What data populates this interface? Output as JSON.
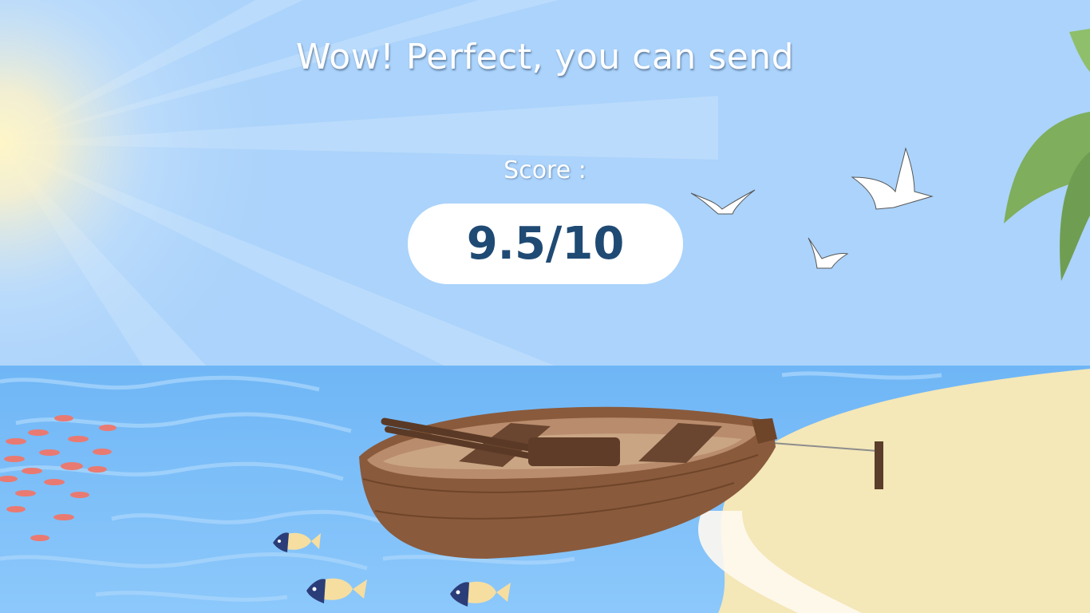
{
  "message": {
    "headline": "Wow! Perfect, you can send"
  },
  "score": {
    "label": "Score :",
    "value": "9.5/10"
  },
  "colors": {
    "sky": "#abd3fb",
    "sea": "#7fbff8",
    "sand": "#f4e7b8",
    "boat": "#8a5a3c",
    "score_text": "#1f4a74"
  }
}
